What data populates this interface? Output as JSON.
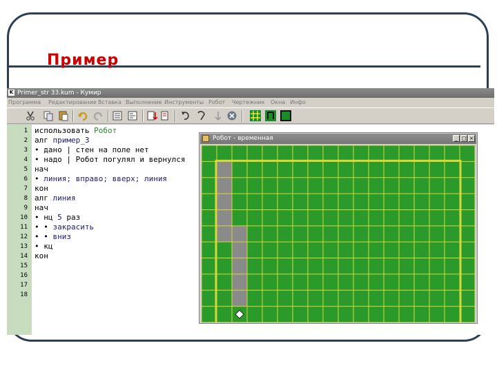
{
  "slide": {
    "title": "Пример"
  },
  "app": {
    "icon_letter": "K",
    "title": "Primer_str 33.kum - Кумир",
    "menu": [
      "Программа",
      "Редактирование",
      "Вставка",
      "Выполнение",
      "Инструменты",
      "Робот",
      "Чертежник",
      "Окна",
      "Инфо"
    ],
    "toolbar_icons": [
      "cut-icon",
      "copy-icon",
      "paste-icon",
      "undo-icon",
      "redo-icon",
      "insert-left-icon",
      "insert-right-icon",
      "step-into-icon",
      "step-over-icon",
      "run-icon",
      "stop-icon",
      "grid-view-icon",
      "pen-view-icon",
      "field-view-icon"
    ]
  },
  "editor": {
    "line_numbers": [
      "1",
      "2",
      "3",
      "4",
      "5",
      "6",
      "7",
      "8",
      "9",
      "10",
      "11",
      "12",
      "13",
      "14",
      "15",
      "16",
      "17",
      "18"
    ],
    "lines": [
      [
        {
          "t": "использовать ",
          "c": "kw"
        },
        {
          "t": "Робот",
          "c": "gn"
        }
      ],
      [
        {
          "t": "алг ",
          "c": "kw"
        },
        {
          "t": "пример_3",
          "c": "nm"
        }
      ],
      [
        {
          "t": "• дано | стен на поле нет",
          "c": "kw"
        }
      ],
      [
        {
          "t": "• надо | Робот погулял и вернулся",
          "c": "kw"
        }
      ],
      [
        {
          "t": "нач",
          "c": "kw"
        }
      ],
      [
        {
          "t": "• ",
          "c": "kw"
        },
        {
          "t": "линия; вправо; вверх; линия",
          "c": "nm"
        }
      ],
      [
        {
          "t": "кон",
          "c": "kw"
        }
      ],
      [
        {
          "t": "алг ",
          "c": "kw"
        },
        {
          "t": "линия",
          "c": "nm"
        }
      ],
      [
        {
          "t": "нач",
          "c": "kw"
        }
      ],
      [
        {
          "t": "• нц ",
          "c": "kw"
        },
        {
          "t": "5",
          "c": "num"
        },
        {
          "t": " раз",
          "c": "kw"
        }
      ],
      [
        {
          "t": "• • ",
          "c": "kw"
        },
        {
          "t": "закрасить",
          "c": "nm"
        }
      ],
      [
        {
          "t": "• • ",
          "c": "kw"
        },
        {
          "t": "вниз",
          "c": "nm"
        }
      ],
      [
        {
          "t": "• кц",
          "c": "kw"
        }
      ],
      [
        {
          "t": "кон",
          "c": "kw"
        }
      ]
    ]
  },
  "robot_window": {
    "title": "Робот - временная",
    "buttons": [
      "_",
      "□",
      "×"
    ],
    "field": {
      "cols": 18,
      "rows": 11,
      "field_color": "#2a9a2a",
      "grid_color": "#d8d838",
      "painted_color": "#8a8a8a",
      "painted_cells": [
        [
          1,
          1
        ],
        [
          1,
          2
        ],
        [
          1,
          3
        ],
        [
          1,
          4
        ],
        [
          1,
          5
        ],
        [
          2,
          5
        ],
        [
          2,
          6
        ],
        [
          2,
          7
        ],
        [
          2,
          8
        ],
        [
          2,
          9
        ]
      ],
      "robot_cell": [
        2,
        10
      ]
    }
  }
}
